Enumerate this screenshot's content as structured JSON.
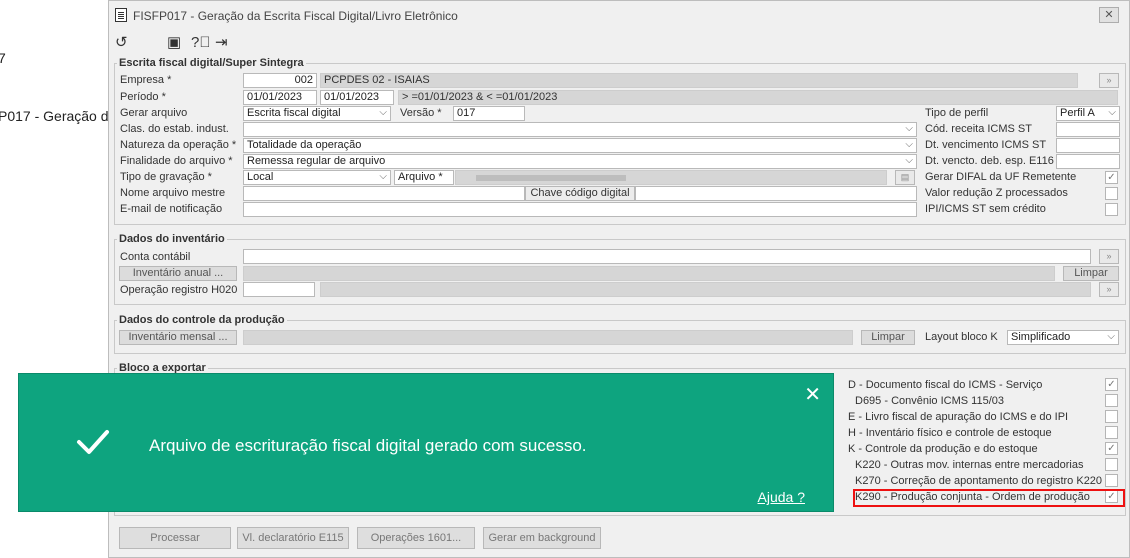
{
  "background": {
    "frag1": "P017 - Geração d",
    "frag2": "7"
  },
  "window": {
    "title": "FISFP017 - Geração da Escrita Fiscal Digital/Livro Eletrônico",
    "close_icon": "close-icon"
  },
  "toolbar": {
    "icons": [
      "undo-icon",
      "calendar-icon",
      "help-icon",
      "exit-icon"
    ]
  },
  "sped": {
    "legend": "Escrita fiscal digital/Super Sintegra",
    "empresa_label": "Empresa *",
    "empresa_code": "002",
    "empresa_name": "PCPDES 02 - ISAIAS",
    "periodo_label": "Período *",
    "periodo_start": "01/01/2023",
    "periodo_end": "01/01/2023",
    "periodo_expr": "> =01/01/2023 & < =01/01/2023",
    "gerar_label": "Gerar arquivo",
    "gerar_value": "Escrita fiscal digital",
    "versao_label": "Versão *",
    "versao_value": "017",
    "clas_label": "Clas. do estab. indust.",
    "clas_value": "",
    "natureza_label": "Natureza da operação *",
    "natureza_value": "Totalidade da operação",
    "finalidade_label": "Finalidade do arquivo *",
    "finalidade_value": "Remessa regular de arquivo",
    "tipo_grav_label": "Tipo de gravação *",
    "tipo_grav_value": "Local",
    "arquivo_label": "Arquivo *",
    "nome_mestre_label": "Nome arquivo mestre",
    "chave_label": "Chave código digital",
    "email_label": "E-mail de notificação",
    "tipo_perfil_label": "Tipo de perfil",
    "tipo_perfil_value": "Perfil A",
    "cod_receita_label": "Cód. receita ICMS ST",
    "dt_venc_label": "Dt. vencimento ICMS ST",
    "dt_vencto_label": "Dt. vencto. deb. esp. E116",
    "difal_label": "Gerar DIFAL da UF Remetente",
    "difal_checked": true,
    "reducao_label": "Valor redução Z processados",
    "reducao_checked": false,
    "ipi_label": "IPI/ICMS ST sem crédito",
    "ipi_checked": false
  },
  "inventario": {
    "legend": "Dados do inventário",
    "conta_label": "Conta contábil",
    "anual_button": "Inventário anual ...",
    "limpar_button": "Limpar",
    "h020_label": "Operação registro H020"
  },
  "producao": {
    "legend": "Dados do controle da produção",
    "mensal_button": "Inventário mensal ...",
    "limpar_button": "Limpar",
    "layout_label": "Layout bloco K",
    "layout_value": "Simplificado"
  },
  "bloco": {
    "legend": "Bloco a exportar",
    "items": [
      {
        "label": "D - Documento fiscal do ICMS - Serviço",
        "checked": true
      },
      {
        "label": "D695 - Convênio ICMS 115/03",
        "checked": false
      },
      {
        "label": "E - Livro fiscal de apuração do ICMS e do IPI",
        "checked": false
      },
      {
        "label": "H - Inventário físico e controle de estoque",
        "checked": false
      },
      {
        "label": "K - Controle da produção e do estoque",
        "checked": true
      },
      {
        "label": "K220 - Outras mov. internas entre mercadorias",
        "checked": false
      },
      {
        "label": "K270 - Correção de apontamento do registro K220",
        "checked": false
      },
      {
        "label": "K290 - Produção conjunta - Ordem de produção",
        "checked": true
      }
    ]
  },
  "footer": {
    "processar": "Processar",
    "vl_declaratorio": "Vl. declaratório E115",
    "operacoes": "Operações 1601...",
    "gerar_background": "Gerar em background"
  },
  "toast": {
    "message": "Arquivo de escrituração fiscal digital gerado com sucesso.",
    "help_link": "Ajuda ?",
    "accent_color": "#0ea47f"
  }
}
